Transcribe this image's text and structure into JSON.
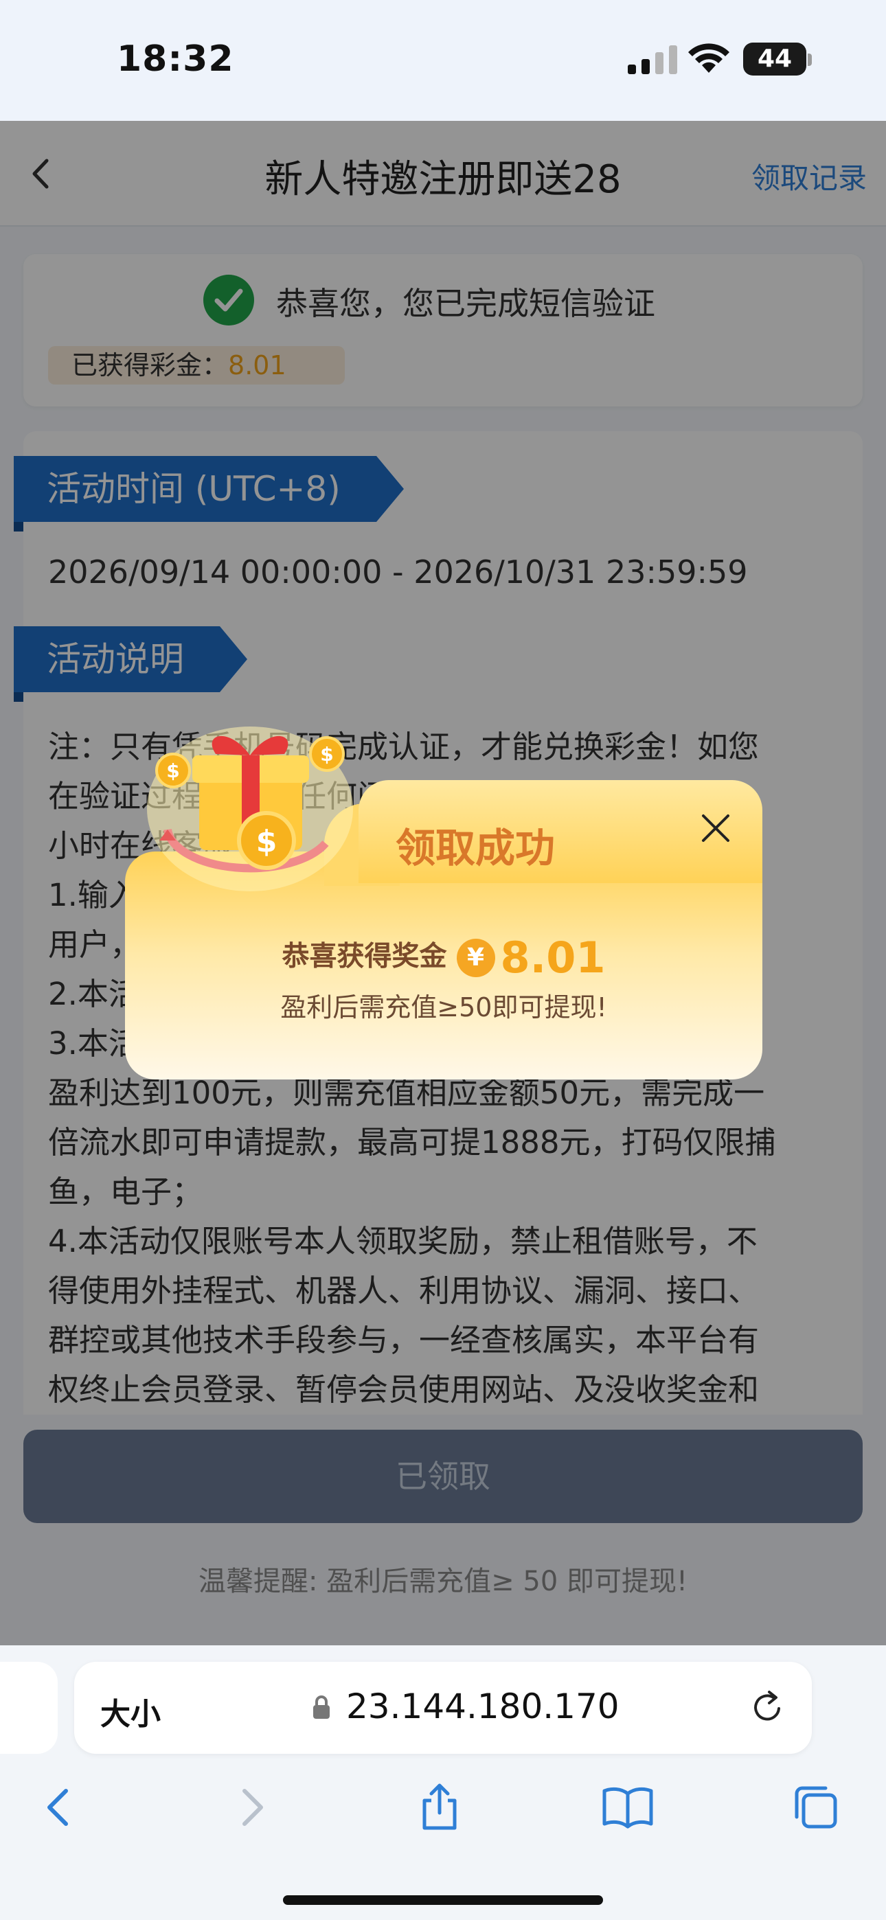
{
  "status_bar": {
    "time": "18:32",
    "battery": "44"
  },
  "nav": {
    "title": "新人特邀注册即送28",
    "record": "领取记录"
  },
  "verify": {
    "message": "恭喜您，您已完成短信验证",
    "bonus_label": "已获得彩金：",
    "bonus_amount": "8.01"
  },
  "sections": {
    "time_title": "活动时间 (UTC+8)",
    "time_range": "2026/09/14 00:00:00 - 2026/10/31 23:59:59",
    "desc_title": "活动说明"
  },
  "description": "注：只有凭手机号码完成认证，才能兑换彩金！如您\n在验证过程中遇到任何问题，请联系在线客服 7*24\n小时在线客服处理\n1.输入手机号码完成验证，即可获得彩金，限特邀\n用户，\n2.本活动\n3.本活动彩金需满足流水后可提现，例如：会员A若\n盈利达到100元，则需充值相应金额50元，需完成一\n倍流水即可申请提款，最高可提1888元，打码仅限捕\n鱼，电子；\n4.本活动仅限账号本人领取奖励，禁止租借账号，不\n得使用外挂程式、机器人、利用协议、漏洞、接口、\n群控或其他技术手段参与，一经查核属实，本平台有\n权终止会员登录、暂停会员使用网站、及没收奖金和",
  "footer": {
    "button": "已领取",
    "reminder": "温馨提醒: 盈利后需充值≥ 50 即可提现!"
  },
  "modal": {
    "title": "领取成功",
    "bonus_label": "恭喜获得奖金",
    "currency": "¥",
    "amount": "8.01",
    "note": "盈利后需充值≥50即可提现!"
  },
  "browser": {
    "text_size": "大小",
    "url": "23.144.180.170"
  },
  "colors": {
    "primary_blue": "#1f6fc9",
    "bonus_orange": "#f0a21a",
    "success_green": "#21a64a",
    "modal_gold": "#ffd257"
  }
}
